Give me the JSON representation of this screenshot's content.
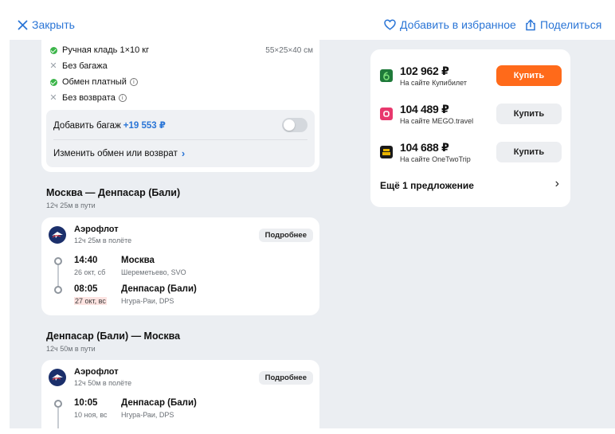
{
  "topbar": {
    "close_label": "Закрыть",
    "favorite_label": "Добавить в избранное",
    "share_label": "Поделиться"
  },
  "baggage": {
    "items": [
      {
        "label": "Ручная кладь 1×10 кг",
        "status": "included",
        "size": "55×25×40 см"
      },
      {
        "label": "Без багажа",
        "status": "excluded"
      },
      {
        "label": "Обмен платный",
        "status": "included",
        "info": true
      },
      {
        "label": "Без возврата",
        "status": "excluded",
        "info": true
      }
    ],
    "add_bag_label": "Добавить багаж",
    "add_bag_price": "+19 553 ₽",
    "add_bag_enabled": false,
    "change_label": "Изменить обмен или возврат"
  },
  "segments": [
    {
      "title": "Москва — Денпасар (Бали)",
      "duration": "12ч 25м в пути",
      "airline": "Аэрофлот",
      "flight_time": "12ч 25м в полёте",
      "more_label": "Подробнее",
      "departure": {
        "time": "14:40",
        "date": "26 окт, сб",
        "city": "Москва",
        "airport": "Шереметьево, SVO"
      },
      "arrival": {
        "time": "08:05",
        "date": "27 окт, вс",
        "city": "Денпасар (Бали)",
        "airport": "Нгура-Раи, DPS"
      }
    },
    {
      "title": "Денпасар (Бали) — Москва",
      "duration": "12ч 50м в пути",
      "airline": "Аэрофлот",
      "flight_time": "12ч 50м в полёте",
      "more_label": "Подробнее",
      "departure": {
        "time": "10:05",
        "date": "10 ноя, вс",
        "city": "Денпасар (Бали)",
        "airport": "Нгура-Раи, DPS"
      }
    }
  ],
  "offers": {
    "items": [
      {
        "price": "102 962 ₽",
        "site": "На сайте Купибилет",
        "buy_label": "Купить",
        "primary": true,
        "logo_color": "#1f7a3a"
      },
      {
        "price": "104 489 ₽",
        "site": "На сайте MEGO.travel",
        "buy_label": "Купить",
        "primary": false,
        "logo_color": "#e8386d"
      },
      {
        "price": "104 688 ₽",
        "site": "На сайте OneTwoTrip",
        "buy_label": "Купить",
        "primary": false,
        "logo_color": "#1a1a1a"
      }
    ],
    "more_label": "Ещё 1 предложение"
  },
  "colors": {
    "accent": "#2a75d6",
    "buy_primary": "#ff6a1a",
    "ok_green": "#3cb54a",
    "background": "#ebeef2"
  }
}
